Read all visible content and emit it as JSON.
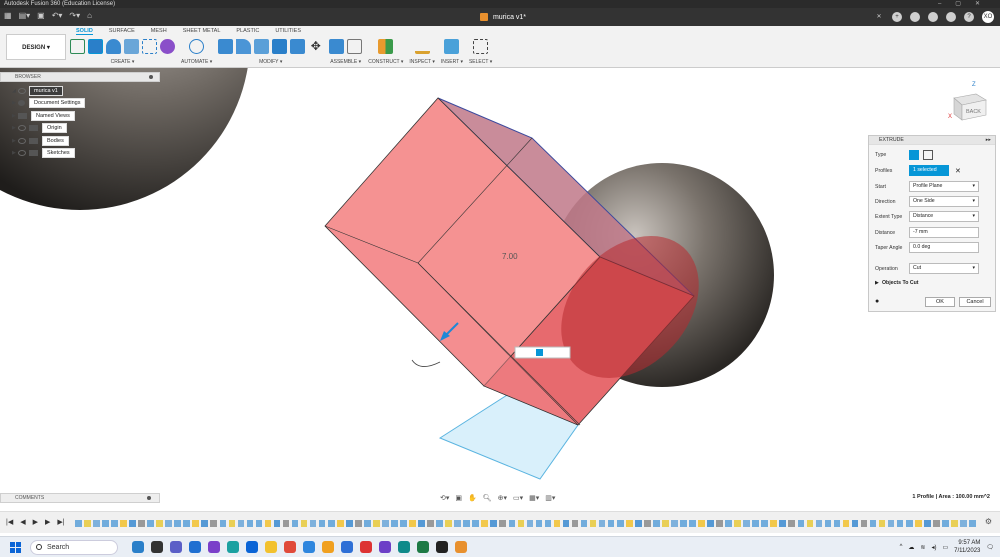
{
  "titlebar": {
    "title": "Autodesk Fusion 360 (Education License)"
  },
  "topbar": {
    "doc_title": "murica v1*",
    "user_initials": "XO"
  },
  "toolbar": {
    "workspace": "DESIGN ▾",
    "tabs": [
      "SOLID",
      "SURFACE",
      "MESH",
      "SHEET METAL",
      "PLASTIC",
      "UTILITIES"
    ],
    "groups": {
      "create": "CREATE ▾",
      "automate": "AUTOMATE ▾",
      "modify": "MODIFY ▾",
      "assemble": "ASSEMBLE ▾",
      "construct": "CONSTRUCT ▾",
      "inspect": "INSPECT ▾",
      "insert": "INSERT ▾",
      "select": "SELECT ▾"
    }
  },
  "browser": {
    "header": "BROWSER",
    "root": "murica v1",
    "items": [
      "Document Settings",
      "Named Views",
      "Origin",
      "Bodies",
      "Sketches"
    ]
  },
  "viewport": {
    "dimension_label": "7.00",
    "viewcube_label": "BACK"
  },
  "extrude": {
    "header": "EXTRUDE",
    "type_label": "Type",
    "profiles_label": "Profiles",
    "profiles_value": "1 selected",
    "start_label": "Start",
    "start_value": "Profile Plane",
    "direction_label": "Direction",
    "direction_value": "One Side",
    "extent_label": "Extent Type",
    "extent_value": "Distance",
    "distance_label": "Distance",
    "distance_value": "-7 mm",
    "taper_label": "Taper Angle",
    "taper_value": "0.0 deg",
    "operation_label": "Operation",
    "operation_value": "Cut",
    "objects_to_cut": "Objects To Cut",
    "ok": "OK",
    "cancel": "Cancel"
  },
  "comments": {
    "label": "COMMENTS"
  },
  "status": {
    "text": "1 Profile | Area : 100.00 mm^2"
  },
  "taskbar": {
    "search_placeholder": "Search",
    "time": "9:57 AM",
    "date": "7/11/2023"
  }
}
